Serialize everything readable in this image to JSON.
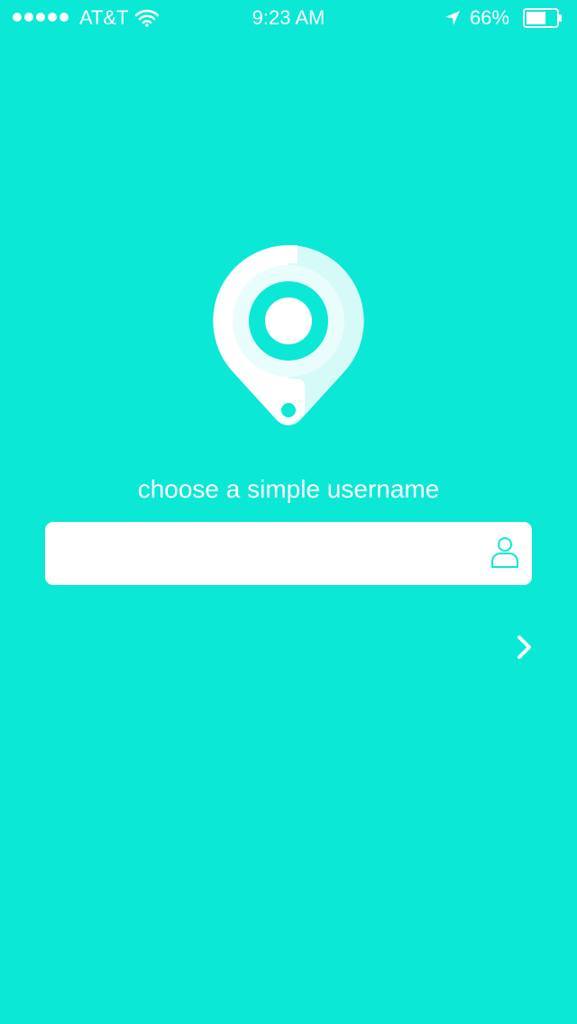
{
  "status_bar": {
    "carrier": "AT&T",
    "time": "9:23 AM",
    "battery_percent": "66%",
    "battery_level": 0.66,
    "signal_dots": 5,
    "icons": [
      "signal-dots-icon",
      "wifi-icon",
      "location-arrow-icon",
      "battery-icon"
    ]
  },
  "logo": {
    "icon": "location-pin-icon"
  },
  "signup": {
    "prompt": "choose a simple username",
    "username_value": "",
    "username_placeholder": "",
    "field_icon": "user-icon",
    "next_icon": "chevron-right-icon"
  },
  "colors": {
    "background": "#0BE8D6",
    "foreground": "#FFFFFF",
    "pin_light": "#D6FAF8",
    "pin_ring": "#E9FDFC"
  }
}
